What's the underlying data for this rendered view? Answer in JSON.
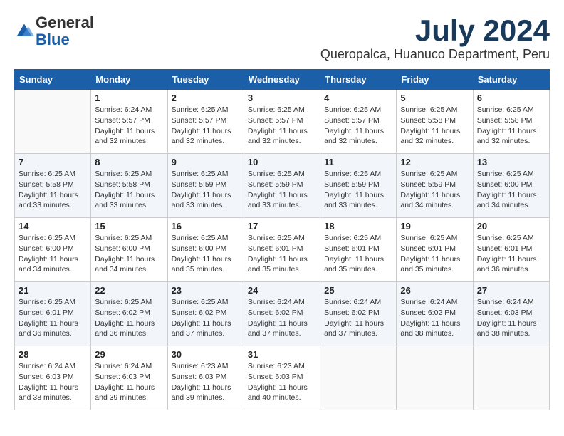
{
  "header": {
    "logo_general": "General",
    "logo_blue": "Blue",
    "month_title": "July 2024",
    "location": "Queropalca, Huanuco Department, Peru"
  },
  "days_of_week": [
    "Sunday",
    "Monday",
    "Tuesday",
    "Wednesday",
    "Thursday",
    "Friday",
    "Saturday"
  ],
  "weeks": [
    [
      {
        "day": "",
        "info": ""
      },
      {
        "day": "1",
        "info": "Sunrise: 6:24 AM\nSunset: 5:57 PM\nDaylight: 11 hours\nand 32 minutes."
      },
      {
        "day": "2",
        "info": "Sunrise: 6:25 AM\nSunset: 5:57 PM\nDaylight: 11 hours\nand 32 minutes."
      },
      {
        "day": "3",
        "info": "Sunrise: 6:25 AM\nSunset: 5:57 PM\nDaylight: 11 hours\nand 32 minutes."
      },
      {
        "day": "4",
        "info": "Sunrise: 6:25 AM\nSunset: 5:57 PM\nDaylight: 11 hours\nand 32 minutes."
      },
      {
        "day": "5",
        "info": "Sunrise: 6:25 AM\nSunset: 5:58 PM\nDaylight: 11 hours\nand 32 minutes."
      },
      {
        "day": "6",
        "info": "Sunrise: 6:25 AM\nSunset: 5:58 PM\nDaylight: 11 hours\nand 32 minutes."
      }
    ],
    [
      {
        "day": "7",
        "info": "Sunrise: 6:25 AM\nSunset: 5:58 PM\nDaylight: 11 hours\nand 33 minutes."
      },
      {
        "day": "8",
        "info": "Sunrise: 6:25 AM\nSunset: 5:58 PM\nDaylight: 11 hours\nand 33 minutes."
      },
      {
        "day": "9",
        "info": "Sunrise: 6:25 AM\nSunset: 5:59 PM\nDaylight: 11 hours\nand 33 minutes."
      },
      {
        "day": "10",
        "info": "Sunrise: 6:25 AM\nSunset: 5:59 PM\nDaylight: 11 hours\nand 33 minutes."
      },
      {
        "day": "11",
        "info": "Sunrise: 6:25 AM\nSunset: 5:59 PM\nDaylight: 11 hours\nand 33 minutes."
      },
      {
        "day": "12",
        "info": "Sunrise: 6:25 AM\nSunset: 5:59 PM\nDaylight: 11 hours\nand 34 minutes."
      },
      {
        "day": "13",
        "info": "Sunrise: 6:25 AM\nSunset: 6:00 PM\nDaylight: 11 hours\nand 34 minutes."
      }
    ],
    [
      {
        "day": "14",
        "info": "Sunrise: 6:25 AM\nSunset: 6:00 PM\nDaylight: 11 hours\nand 34 minutes."
      },
      {
        "day": "15",
        "info": "Sunrise: 6:25 AM\nSunset: 6:00 PM\nDaylight: 11 hours\nand 34 minutes."
      },
      {
        "day": "16",
        "info": "Sunrise: 6:25 AM\nSunset: 6:00 PM\nDaylight: 11 hours\nand 35 minutes."
      },
      {
        "day": "17",
        "info": "Sunrise: 6:25 AM\nSunset: 6:01 PM\nDaylight: 11 hours\nand 35 minutes."
      },
      {
        "day": "18",
        "info": "Sunrise: 6:25 AM\nSunset: 6:01 PM\nDaylight: 11 hours\nand 35 minutes."
      },
      {
        "day": "19",
        "info": "Sunrise: 6:25 AM\nSunset: 6:01 PM\nDaylight: 11 hours\nand 35 minutes."
      },
      {
        "day": "20",
        "info": "Sunrise: 6:25 AM\nSunset: 6:01 PM\nDaylight: 11 hours\nand 36 minutes."
      }
    ],
    [
      {
        "day": "21",
        "info": "Sunrise: 6:25 AM\nSunset: 6:01 PM\nDaylight: 11 hours\nand 36 minutes."
      },
      {
        "day": "22",
        "info": "Sunrise: 6:25 AM\nSunset: 6:02 PM\nDaylight: 11 hours\nand 36 minutes."
      },
      {
        "day": "23",
        "info": "Sunrise: 6:25 AM\nSunset: 6:02 PM\nDaylight: 11 hours\nand 37 minutes."
      },
      {
        "day": "24",
        "info": "Sunrise: 6:24 AM\nSunset: 6:02 PM\nDaylight: 11 hours\nand 37 minutes."
      },
      {
        "day": "25",
        "info": "Sunrise: 6:24 AM\nSunset: 6:02 PM\nDaylight: 11 hours\nand 37 minutes."
      },
      {
        "day": "26",
        "info": "Sunrise: 6:24 AM\nSunset: 6:02 PM\nDaylight: 11 hours\nand 38 minutes."
      },
      {
        "day": "27",
        "info": "Sunrise: 6:24 AM\nSunset: 6:03 PM\nDaylight: 11 hours\nand 38 minutes."
      }
    ],
    [
      {
        "day": "28",
        "info": "Sunrise: 6:24 AM\nSunset: 6:03 PM\nDaylight: 11 hours\nand 38 minutes."
      },
      {
        "day": "29",
        "info": "Sunrise: 6:24 AM\nSunset: 6:03 PM\nDaylight: 11 hours\nand 39 minutes."
      },
      {
        "day": "30",
        "info": "Sunrise: 6:23 AM\nSunset: 6:03 PM\nDaylight: 11 hours\nand 39 minutes."
      },
      {
        "day": "31",
        "info": "Sunrise: 6:23 AM\nSunset: 6:03 PM\nDaylight: 11 hours\nand 40 minutes."
      },
      {
        "day": "",
        "info": ""
      },
      {
        "day": "",
        "info": ""
      },
      {
        "day": "",
        "info": ""
      }
    ]
  ]
}
